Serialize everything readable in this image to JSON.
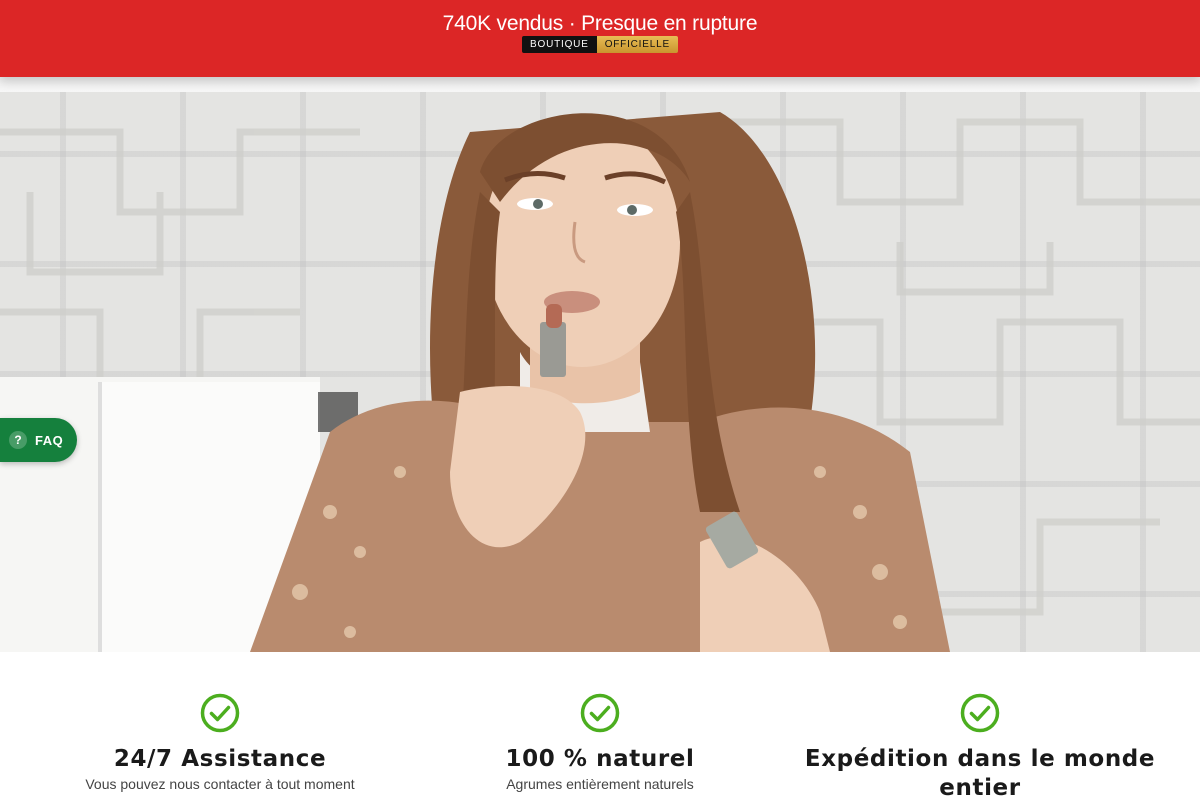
{
  "banner": {
    "title": "740K vendus · Presque en rupture",
    "badge_left": "BOUTIQUE",
    "badge_right": "OFFICIELLE",
    "background": "#dc2626"
  },
  "hero": {
    "image_description": "woman-applying-lipstick"
  },
  "faq": {
    "icon_glyph": "?",
    "label": "FAQ",
    "color": "#15803d"
  },
  "features": [
    {
      "icon": "check-circle-icon",
      "title": "24/7 Assistance",
      "text": "Vous pouvez nous contacter à tout moment"
    },
    {
      "icon": "check-circle-icon",
      "title": "100 % naturel",
      "text": "Agrumes entièrement naturels"
    },
    {
      "icon": "check-circle-icon",
      "title": "Expédition dans le monde entier",
      "text": ""
    }
  ],
  "accent_green": "#4cae1f"
}
